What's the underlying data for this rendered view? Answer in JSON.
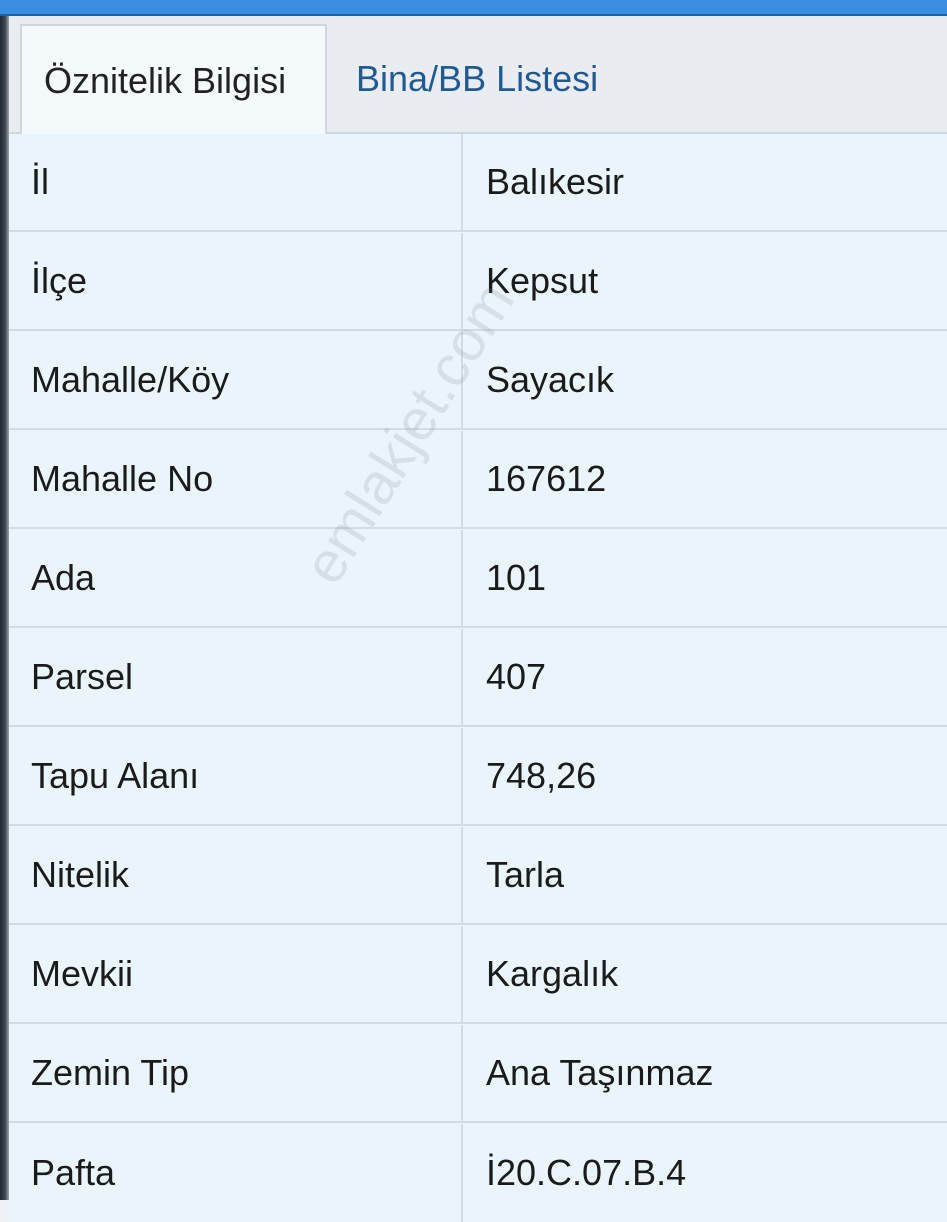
{
  "tabs": [
    {
      "label": "Öznitelik Bilgisi",
      "active": true
    },
    {
      "label": "Bina/BB Listesi",
      "active": false
    }
  ],
  "rows": [
    {
      "key": "İl",
      "value": "Balıkesir"
    },
    {
      "key": "İlçe",
      "value": "Kepsut"
    },
    {
      "key": "Mahalle/Köy",
      "value": "Sayacık"
    },
    {
      "key": "Mahalle No",
      "value": "167612"
    },
    {
      "key": "Ada",
      "value": "101"
    },
    {
      "key": "Parsel",
      "value": "407"
    },
    {
      "key": "Tapu Alanı",
      "value": "748,26"
    },
    {
      "key": "Nitelik",
      "value": "Tarla"
    },
    {
      "key": "Mevkii",
      "value": "Kargalık"
    },
    {
      "key": "Zemin Tip",
      "value": "Ana Taşınmaz"
    },
    {
      "key": "Pafta",
      "value": "İ20.C.07.B.4"
    }
  ],
  "watermark": "emlakjet.com",
  "colors": {
    "accent": "#3a8ee0",
    "tab_link": "#1f5a93",
    "table_bg": "#eaf5fb"
  }
}
